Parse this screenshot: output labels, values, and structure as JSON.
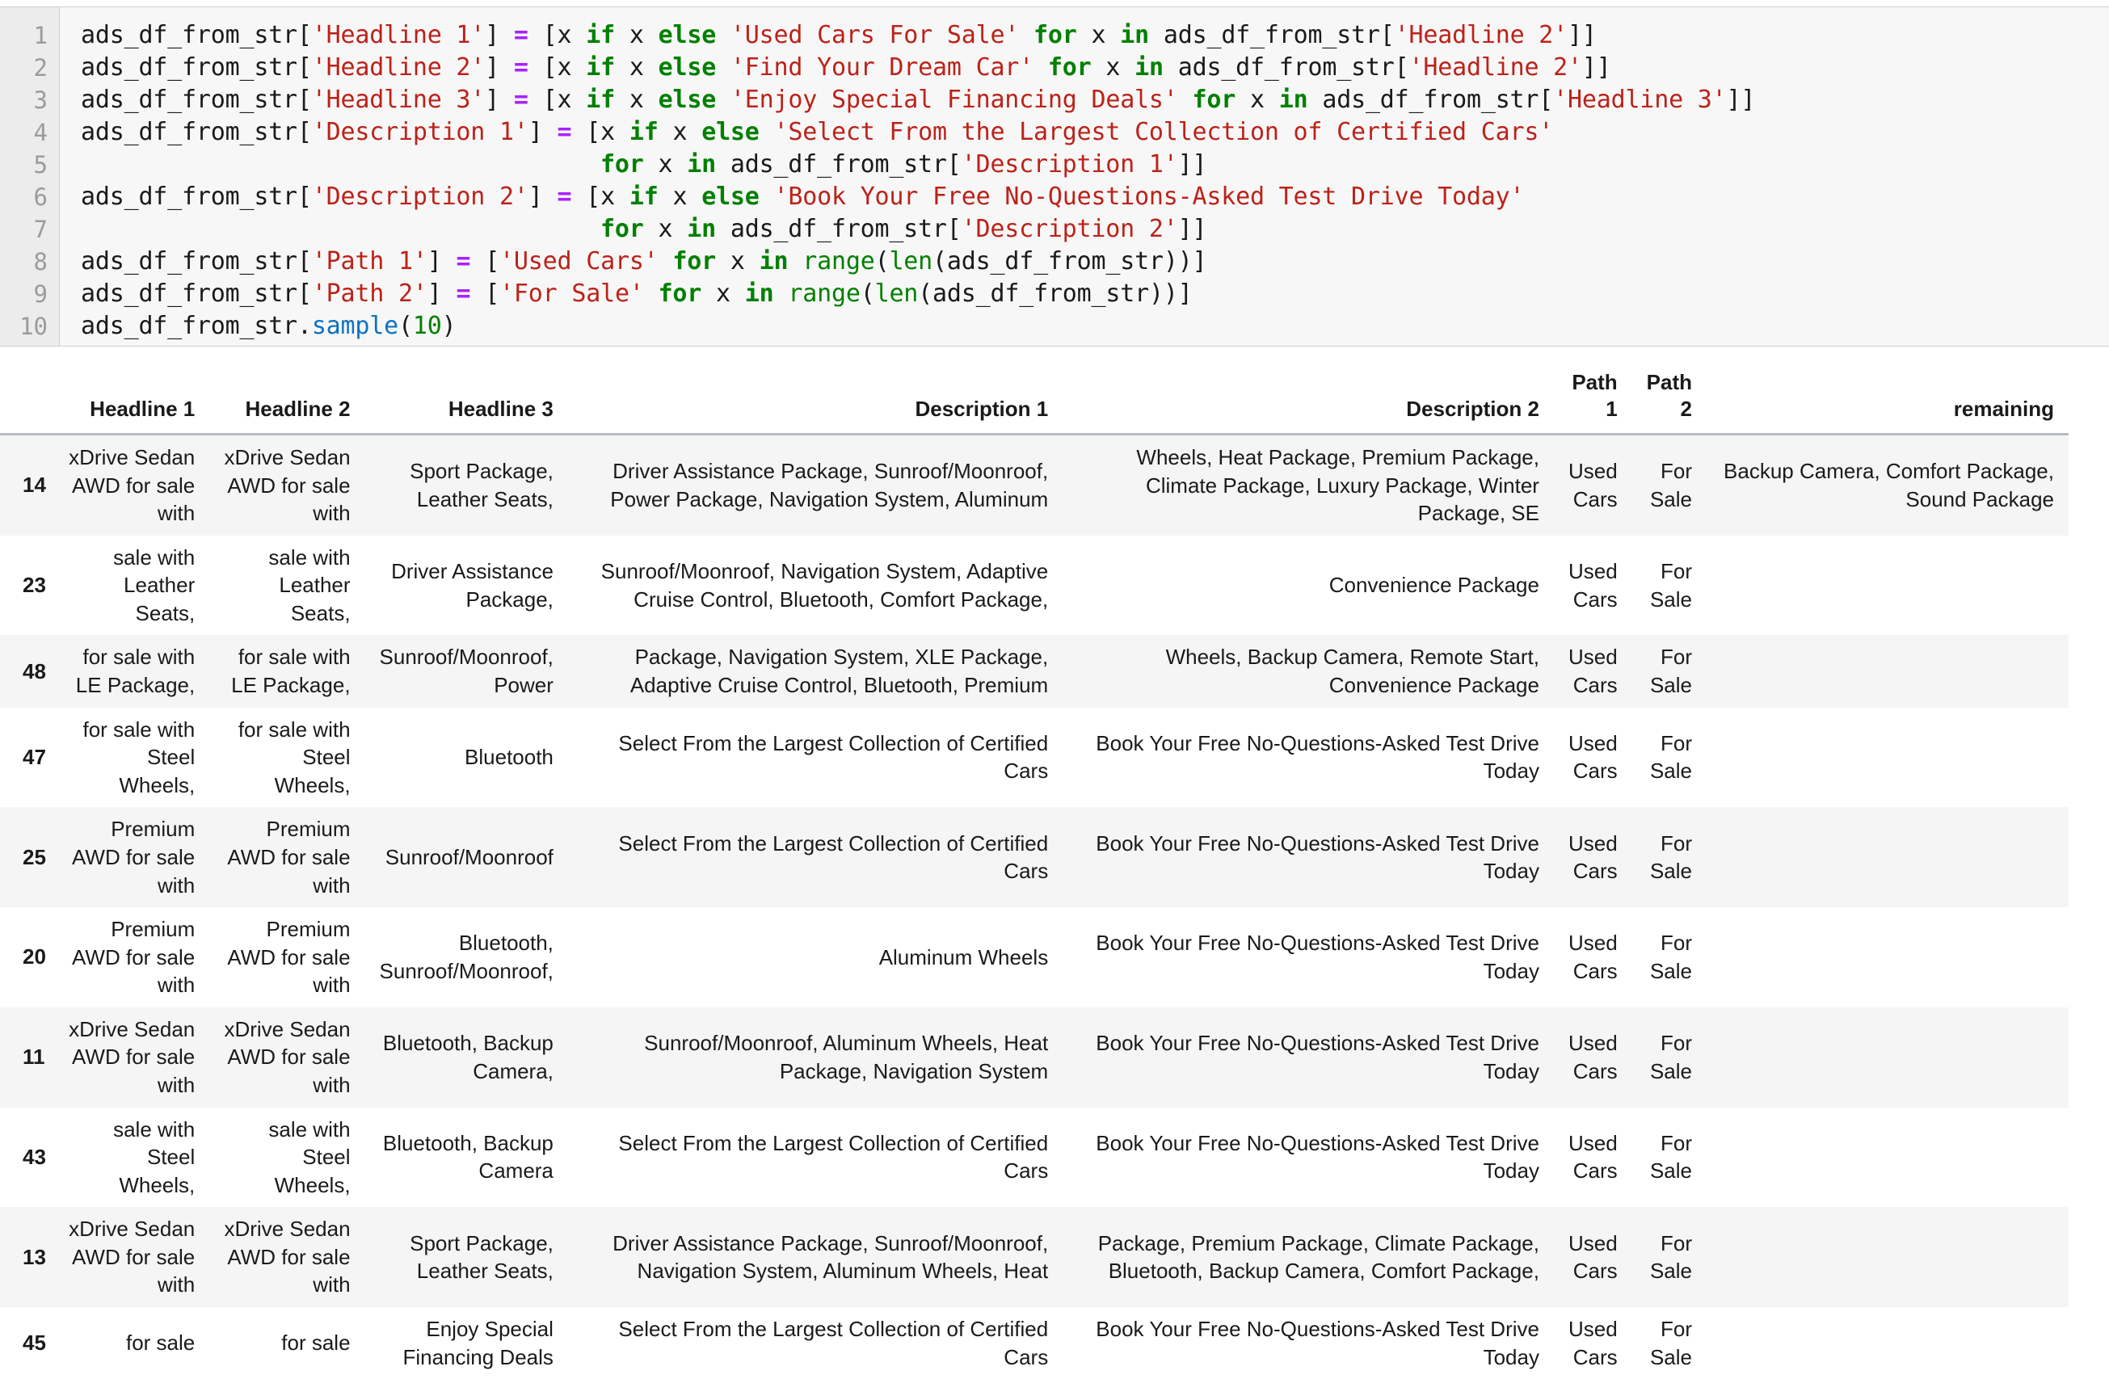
{
  "code_cell": {
    "line_numbers": [
      "1",
      "2",
      "3",
      "4",
      "5",
      "6",
      "7",
      "8",
      "9",
      "10"
    ],
    "lines": [
      "ads_df_from_str['Headline 1'] = [x if x else 'Used Cars For Sale' for x in ads_df_from_str['Headline 2']]",
      "ads_df_from_str['Headline 2'] = [x if x else 'Find Your Dream Car' for x in ads_df_from_str['Headline 2']]",
      "ads_df_from_str['Headline 3'] = [x if x else 'Enjoy Special Financing Deals' for x in ads_df_from_str['Headline 3']]",
      "ads_df_from_str['Description 1'] = [x if x else 'Select From the Largest Collection of Certified Cars'",
      "                                    for x in ads_df_from_str['Description 1']]",
      "ads_df_from_str['Description 2'] = [x if x else 'Book Your Free No-Questions-Asked Test Drive Today'",
      "                                    for x in ads_df_from_str['Description 2']]",
      "ads_df_from_str['Path 1'] = ['Used Cars' for x in range(len(ads_df_from_str))]",
      "ads_df_from_str['Path 2'] = ['For Sale' for x in range(len(ads_df_from_str))]",
      "ads_df_from_str.sample(10)"
    ],
    "colors": {
      "string": "#bc2219",
      "keyword": "#008000",
      "operator": "#aa22ff",
      "function": "#0c72c4",
      "plain": "#1a1a1a",
      "gutter_text": "#9b9b9b",
      "background": "#f7f7f7",
      "gutter_background": "#ececec"
    }
  },
  "table": {
    "index_header": "",
    "columns": [
      "Headline 1",
      "Headline 2",
      "Headline 3",
      "Description 1",
      "Description 2",
      "Path 1",
      "Path 2",
      "remaining"
    ],
    "rows": [
      {
        "index": "14",
        "headline_1": "xDrive Sedan AWD for sale with",
        "headline_2": "xDrive Sedan AWD for sale with",
        "headline_3": "Sport Package, Leather Seats,",
        "description_1": "Driver Assistance Package, Sunroof/Moonroof, Power Package, Navigation System, Aluminum",
        "description_2": "Wheels, Heat Package, Premium Package, Climate Package, Luxury Package, Winter Package, SE",
        "path_1": "Used Cars",
        "path_2": "For Sale",
        "remaining": "Backup Camera, Comfort Package, Sound Package"
      },
      {
        "index": "23",
        "headline_1": "sale with Leather Seats,",
        "headline_2": "sale with Leather Seats,",
        "headline_3": "Driver Assistance Package,",
        "description_1": "Sunroof/Moonroof, Navigation System, Adaptive Cruise Control, Bluetooth, Comfort Package,",
        "description_2": "Convenience Package",
        "path_1": "Used Cars",
        "path_2": "For Sale",
        "remaining": ""
      },
      {
        "index": "48",
        "headline_1": "for sale with LE Package,",
        "headline_2": "for sale with LE Package,",
        "headline_3": "Sunroof/Moonroof, Power",
        "description_1": "Package, Navigation System, XLE Package, Adaptive Cruise Control, Bluetooth, Premium",
        "description_2": "Wheels, Backup Camera, Remote Start, Convenience Package",
        "path_1": "Used Cars",
        "path_2": "For Sale",
        "remaining": ""
      },
      {
        "index": "47",
        "headline_1": "for sale with Steel Wheels,",
        "headline_2": "for sale with Steel Wheels,",
        "headline_3": "Bluetooth",
        "description_1": "Select From the Largest Collection of Certified Cars",
        "description_2": "Book Your Free No-Questions-Asked Test Drive Today",
        "path_1": "Used Cars",
        "path_2": "For Sale",
        "remaining": ""
      },
      {
        "index": "25",
        "headline_1": "Premium AWD for sale with",
        "headline_2": "Premium AWD for sale with",
        "headline_3": "Sunroof/Moonroof",
        "description_1": "Select From the Largest Collection of Certified Cars",
        "description_2": "Book Your Free No-Questions-Asked Test Drive Today",
        "path_1": "Used Cars",
        "path_2": "For Sale",
        "remaining": ""
      },
      {
        "index": "20",
        "headline_1": "Premium AWD for sale with",
        "headline_2": "Premium AWD for sale with",
        "headline_3": "Bluetooth, Sunroof/Moonroof,",
        "description_1": "Aluminum Wheels",
        "description_2": "Book Your Free No-Questions-Asked Test Drive Today",
        "path_1": "Used Cars",
        "path_2": "For Sale",
        "remaining": ""
      },
      {
        "index": "11",
        "headline_1": "xDrive Sedan AWD for sale with",
        "headline_2": "xDrive Sedan AWD for sale with",
        "headline_3": "Bluetooth, Backup Camera,",
        "description_1": "Sunroof/Moonroof, Aluminum Wheels, Heat Package, Navigation System",
        "description_2": "Book Your Free No-Questions-Asked Test Drive Today",
        "path_1": "Used Cars",
        "path_2": "For Sale",
        "remaining": ""
      },
      {
        "index": "43",
        "headline_1": "sale with Steel Wheels,",
        "headline_2": "sale with Steel Wheels,",
        "headline_3": "Bluetooth, Backup Camera",
        "description_1": "Select From the Largest Collection of Certified Cars",
        "description_2": "Book Your Free No-Questions-Asked Test Drive Today",
        "path_1": "Used Cars",
        "path_2": "For Sale",
        "remaining": ""
      },
      {
        "index": "13",
        "headline_1": "xDrive Sedan AWD for sale with",
        "headline_2": "xDrive Sedan AWD for sale with",
        "headline_3": "Sport Package, Leather Seats,",
        "description_1": "Driver Assistance Package, Sunroof/Moonroof, Navigation System, Aluminum Wheels, Heat",
        "description_2": "Package, Premium Package, Climate Package, Bluetooth, Backup Camera, Comfort Package,",
        "path_1": "Used Cars",
        "path_2": "For Sale",
        "remaining": ""
      },
      {
        "index": "45",
        "headline_1": "for sale",
        "headline_2": "for sale",
        "headline_3": "Enjoy Special Financing Deals",
        "description_1": "Select From the Largest Collection of Certified Cars",
        "description_2": "Book Your Free No-Questions-Asked Test Drive Today",
        "path_1": "Used Cars",
        "path_2": "For Sale",
        "remaining": ""
      }
    ]
  }
}
